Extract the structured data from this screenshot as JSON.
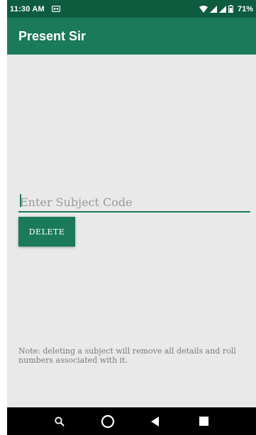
{
  "status_bar": {
    "time": "11:30 AM",
    "battery_percent": "71%"
  },
  "app_bar": {
    "title": "Present Sir"
  },
  "form": {
    "subject_placeholder": "Enter Subject Code",
    "subject_value": "",
    "delete_label": "DELETE"
  },
  "note": {
    "text": "Note: deleting a subject will remove all details and roll numbers associated with it."
  },
  "nav_bar": {
    "icons": [
      "search-icon",
      "home-icon",
      "back-icon",
      "recents-icon"
    ]
  },
  "colors": {
    "status_bar": "#0e5c40",
    "primary": "#1b7a5a",
    "background": "#e9e9e9"
  }
}
